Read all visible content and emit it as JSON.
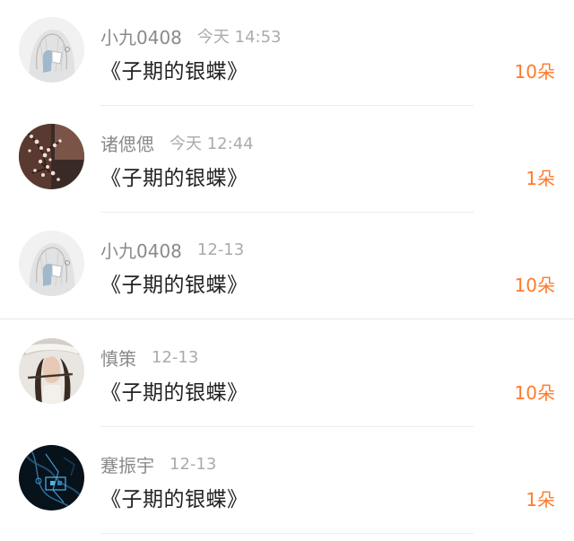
{
  "gifts": [
    {
      "name": "小九0408",
      "time": "今天 14:53",
      "message": "《子期的银蝶》",
      "amount": "10朵",
      "avatar_icon": "avatar-girl-sketch-icon"
    },
    {
      "name": "诸偲偲",
      "time": "今天 12:44",
      "message": "《子期的银蝶》",
      "amount": "1朵",
      "avatar_icon": "avatar-blossom-photo-icon"
    },
    {
      "name": "小九0408",
      "time": "12-13",
      "message": "《子期的银蝶》",
      "amount": "10朵",
      "avatar_icon": "avatar-girl-sketch-icon"
    },
    {
      "name": "慎策",
      "time": "12-13",
      "message": "《子期的银蝶》",
      "amount": "10朵",
      "avatar_icon": "avatar-woman-veil-icon"
    },
    {
      "name": "蹇振宇",
      "time": "12-13",
      "message": "《子期的银蝶》",
      "amount": "1朵",
      "avatar_icon": "avatar-dark-tech-icon"
    }
  ],
  "colors": {
    "amount": "#ff7a2b",
    "name": "#8a8a8a",
    "time": "#ababab",
    "message": "#222222"
  }
}
